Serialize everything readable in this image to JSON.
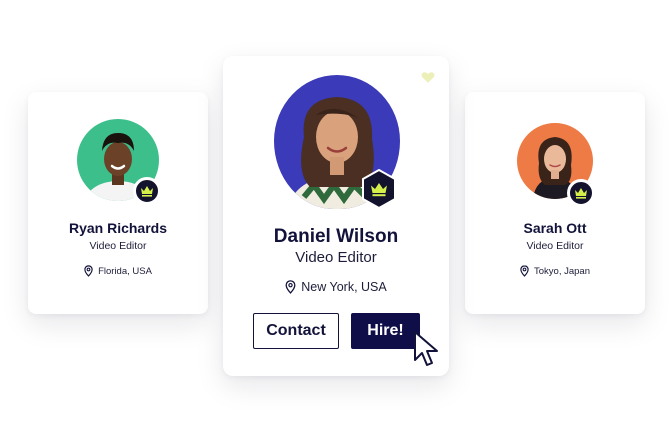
{
  "profiles": {
    "left": {
      "name": "Ryan Richards",
      "role": "Video Editor",
      "location": "Florida, USA",
      "avatar_bg": "#3dbf8c"
    },
    "main": {
      "name": "Daniel Wilson",
      "role": "Video Editor",
      "location": "New York, USA",
      "avatar_bg": "#3b3ab8",
      "contact_label": "Contact",
      "hire_label": "Hire!",
      "favorited": true
    },
    "right": {
      "name": "Sarah Ott",
      "role": "Video Editor",
      "location": "Tokyo, Japan",
      "avatar_bg": "#ee7a45"
    }
  },
  "icons": {
    "badge": "crown-icon",
    "location": "map-pin-icon",
    "favorite": "heart-icon",
    "pointer": "cursor-arrow-icon"
  },
  "colors": {
    "navy": "#0f0e48",
    "badge_bg": "#13132e",
    "crown": "#d6f04b",
    "heart": "#ecefb8"
  }
}
